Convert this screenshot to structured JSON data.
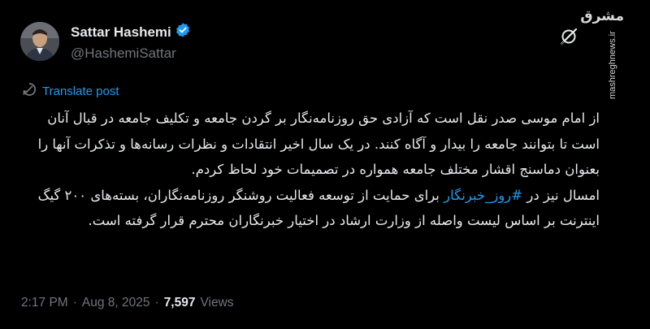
{
  "author": {
    "display_name": "Sattar Hashemi",
    "handle": "@HashemiSattar",
    "verified": true
  },
  "watermark": {
    "logo": "مشرق",
    "url": "mashreghnews.ir"
  },
  "translate_label": "Translate post",
  "tweet": {
    "paragraph1": "از امام موسی صدر نقل است که آزادی حق روزنامه‌نگار بر گردن جامعه و تکلیف جامعه در قبال آنان است تا بتوانند جامعه را بیدار و آگاه کنند. در یک سال اخیر انتقادات و نظرات رسانه‌ها و تذکرات آنها را بعنوان دماسنج اقشار مختلف جامعه همواره در تصمیمات خود لحاظ کردم.",
    "paragraph2_before": "امسال نیز در ",
    "hashtag": "#روز_خبرنگار",
    "paragraph2_after": " برای حمایت از توسعه فعالیت روشنگر روزنامه‌نگاران، بسته‌های ۲۰۰ گیگ اینترنت بر اساس لیست واصله از وزارت ارشاد در اختیار خبرنگاران محترم قرار گرفته است."
  },
  "meta": {
    "time": "2:17 PM",
    "separator": "·",
    "date": "Aug 8, 2025",
    "views_count": "7,597",
    "views_label": "Views"
  },
  "colors": {
    "background": "#000000",
    "text": "#e7e9ea",
    "secondary": "#71767b",
    "accent": "#1d9bf0"
  },
  "icons": {
    "verified": "verified-badge-icon",
    "grok": "grok-icon",
    "translate": "translate-icon"
  }
}
